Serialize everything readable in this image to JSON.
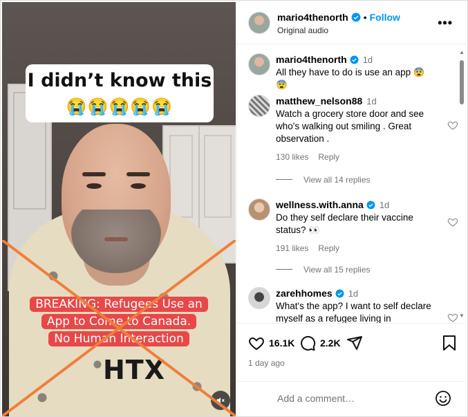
{
  "media": {
    "caption_top": "I didn’t know this",
    "caption_emojis": "😭😭😭😭😭",
    "headline_lines": [
      "BREAKING: Refugees Use an",
      "App to Come to Canada.",
      "No Human Interaction"
    ],
    "shirt_text": "HTX"
  },
  "header": {
    "username": "mario4thenorth",
    "follow_label": "Follow",
    "separator": "•",
    "audio_label": "Original audio",
    "more_label": "•••"
  },
  "comments": [
    {
      "username": "mario4thenorth",
      "verified": true,
      "time": "1d",
      "text": "All they have to do is use an app 😨 😨"
    },
    {
      "username": "matthew_nelson88",
      "verified": false,
      "time": "1d",
      "text": "Watch a grocery store door and see who's walking out smiling . Great observation .",
      "likes": "130 likes",
      "reply": "Reply",
      "view_replies": "View all 14 replies"
    },
    {
      "username": "wellness.with.anna",
      "verified": true,
      "time": "1d",
      "text": "Do they self declare their vaccine status? 👀",
      "likes": "191 likes",
      "reply": "Reply",
      "view_replies": "View all 15 replies"
    },
    {
      "username": "zarehhomes",
      "verified": true,
      "time": "1d",
      "text": "What's the app? I want to self declare myself as a refugee living in"
    }
  ],
  "actions": {
    "likes_count": "16.1K",
    "comments_count": "2.2K",
    "posted_time": "1 day ago"
  },
  "composer": {
    "placeholder": "Add a comment…"
  },
  "colors": {
    "accent": "#0095f6",
    "verified": "#0095f6",
    "headline_bg": "#e84848",
    "x_mark": "#f07e3a"
  }
}
